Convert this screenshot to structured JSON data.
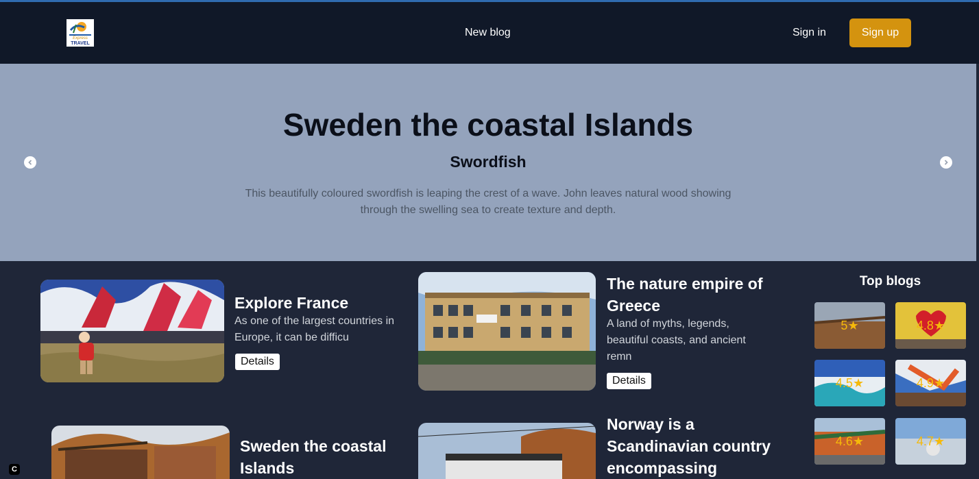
{
  "nav": {
    "logo": {
      "line1": "Express",
      "line2": "TRAVEL"
    },
    "new_blog": "New blog",
    "sign_in": "Sign in",
    "sign_up": "Sign up"
  },
  "hero": {
    "title": "Sweden the coastal Islands",
    "subtitle": "Swordfish",
    "description": "This beautifully coloured swordfish is leaping the crest of a wave. John leaves natural wood showing through the swelling sea to create texture and depth.",
    "prev_icon": "chevron-left-icon",
    "next_icon": "chevron-right-icon"
  },
  "blogs": [
    {
      "title": "Explore France",
      "description": "As one of the largest countries in Europe, it can be difficu",
      "details_label": "Details"
    },
    {
      "title": "The nature empire of Greece",
      "description": "A land of myths, legends, beautiful coasts, and ancient remn",
      "details_label": "Details"
    },
    {
      "title": "Sweden the coastal Islands"
    },
    {
      "title": "Norway is a Scandinavian country encompassing"
    }
  ],
  "top_blogs": {
    "title": "Top blogs",
    "items": [
      {
        "rating": "5"
      },
      {
        "rating": "4.8"
      },
      {
        "rating": "4.5"
      },
      {
        "rating": "4.9"
      },
      {
        "rating": "4.6"
      },
      {
        "rating": "4.7"
      }
    ],
    "star": "★"
  },
  "corner_badge": "C",
  "colors": {
    "navbar": "#101828",
    "hero": "#94a3bc",
    "body": "#1f2638",
    "accent": "#d4930f",
    "rating": "#f5b90a"
  }
}
